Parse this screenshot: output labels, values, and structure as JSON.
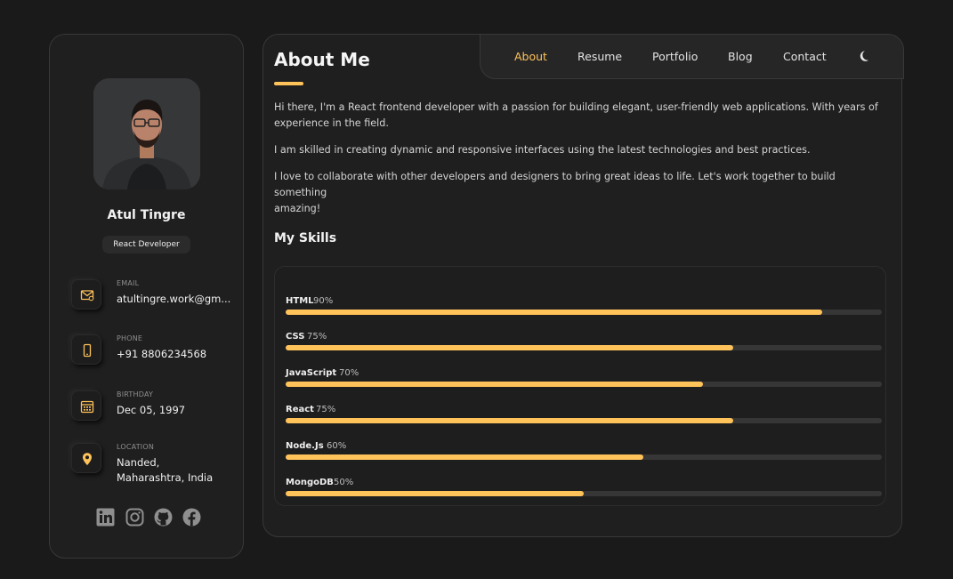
{
  "profile": {
    "name": "Atul Tingre",
    "role": "React Developer"
  },
  "contacts": [
    {
      "label": "EMAIL",
      "value": "atultingre.work@gm...",
      "icon": "mail-icon"
    },
    {
      "label": "PHONE",
      "value": "+91 8806234568",
      "icon": "phone-icon"
    },
    {
      "label": "BIRTHDAY",
      "value": "Dec 05, 1997",
      "icon": "calendar-icon"
    },
    {
      "label": "LOCATION",
      "value": "Nanded,",
      "value2": "Maharashtra, India",
      "icon": "location-pin-icon"
    }
  ],
  "socials": [
    "linkedin-icon",
    "instagram-icon",
    "github-icon",
    "facebook-icon"
  ],
  "nav": {
    "items": [
      "About",
      "Resume",
      "Portfolio",
      "Blog",
      "Contact"
    ],
    "active": "About",
    "theme_icon": "moon-icon"
  },
  "about": {
    "title": "About Me",
    "paragraphs": [
      "Hi there, I'm a React frontend developer with a passion for building elegant, user-friendly web applications. With years of",
      "experience in the field.",
      "I am skilled in creating dynamic and responsive interfaces using the latest technologies and best practices.",
      "I love to collaborate with other developers and designers to bring great ideas to life. Let's work together to build something",
      "amazing!"
    ]
  },
  "skills": {
    "title": "My Skills",
    "items": [
      {
        "name": "HTML",
        "percent": 90,
        "label": "90%"
      },
      {
        "name": "CSS",
        "percent": 75,
        "label": "75%"
      },
      {
        "name": "JavaScript",
        "percent": 70,
        "label": "70%"
      },
      {
        "name": "React",
        "percent": 75,
        "label": "75%"
      },
      {
        "name": "Node.Js",
        "percent": 60,
        "label": "60%"
      },
      {
        "name": "MongoDB",
        "percent": 50,
        "label": "50%"
      }
    ]
  },
  "colors": {
    "accent": "#ffc35a",
    "background": "#1a1a1b",
    "card": "#1f1f20"
  }
}
